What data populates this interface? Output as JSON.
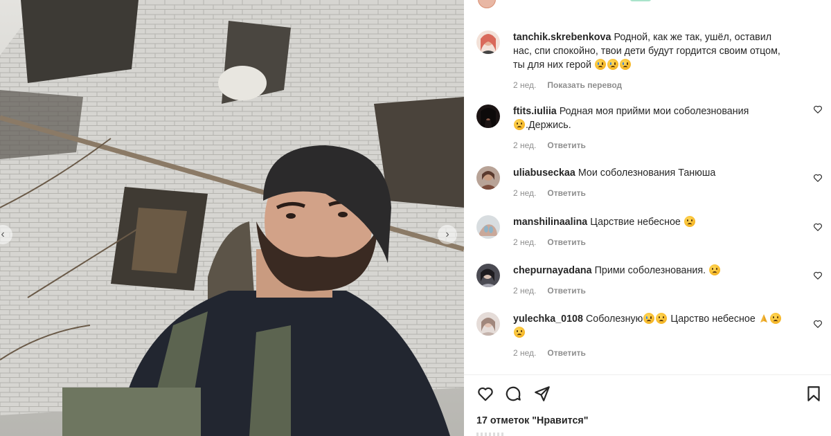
{
  "comments": [
    {
      "username": "tanchik.skrebenkova",
      "text": "Родной, как же так, ушёл, оставил нас, спи спокойно, твои дети будут гордится своим отцом, ты для них герой",
      "emoji": "😭😭😭",
      "time": "2 нед.",
      "action": "Показать перевод",
      "avatar_color": "#d9695a"
    },
    {
      "username": "ftits.iuliia",
      "text": "Родная моя прийми мои соболезнования",
      "emoji_after": "😞",
      "text2": ".Держись.",
      "time": "2 нед.",
      "action": "Ответить",
      "avatar_color": "#2a2020"
    },
    {
      "username": "uliabuseckaa",
      "text": "Мои соболезнования Танюша",
      "time": "2 нед.",
      "action": "Ответить",
      "avatar_color": "#8a6a5a"
    },
    {
      "username": "manshilinaalina",
      "text": "Царствие небесное",
      "emoji": "😞",
      "time": "2 нед.",
      "action": "Ответить",
      "avatar_color": "#9aa3a8"
    },
    {
      "username": "chepurnayadana",
      "text": "Прими соболезнования.",
      "emoji": "😞",
      "time": "2 нед.",
      "action": "Ответить",
      "avatar_color": "#6a6a72"
    },
    {
      "username": "yulechka_0108",
      "text": "Соболезную",
      "emoji_a": "😭😞",
      "text2": "Царство небесное",
      "emoji_b": "🙏😞😞",
      "time": "2 нед.",
      "action": "Ответить",
      "avatar_color": "#b9a7a0"
    }
  ],
  "likes_text": "17 отметок \"Нравится\"",
  "icons": {
    "like": "heart-icon",
    "comment": "comment-bubble-icon",
    "share": "paper-plane-icon",
    "save": "bookmark-icon",
    "prev": "chevron-left-icon",
    "next": "chevron-right-icon"
  }
}
